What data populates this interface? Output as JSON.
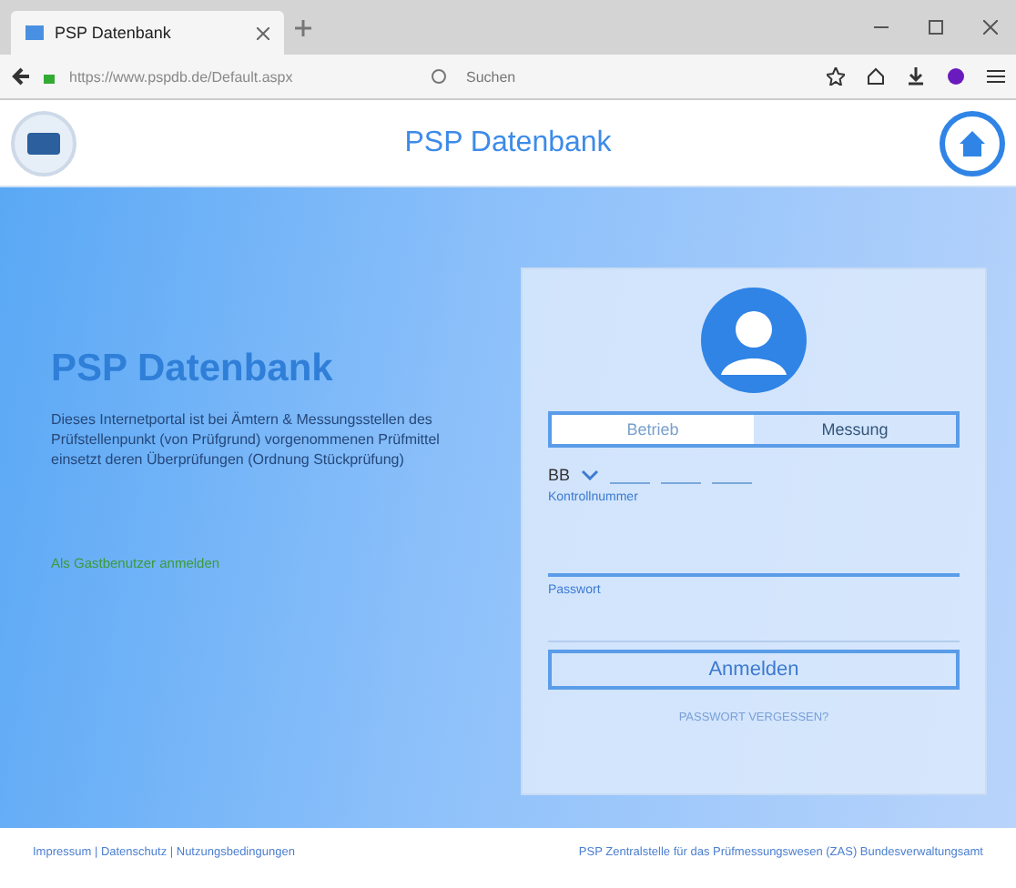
{
  "browser": {
    "tab_title": "PSP Datenbank",
    "address": "https://www.pspdb.de/Default.aspx",
    "search_placeholder": "Suchen"
  },
  "header": {
    "title": "PSP Datenbank"
  },
  "intro": {
    "heading": "PSP Datenbank",
    "text": "Dieses Internetportal ist bei Ämtern & Messungsstellen des Prüfstellenpunkt (von Prüfgrund) vorgenommenen Prüfmittel einsetzt deren Überprüfungen (Ordnung Stückprüfung)",
    "guest_link": "Als Gastbenutzer anmelden"
  },
  "login": {
    "tabs": [
      {
        "label": "Betrieb",
        "selected": true
      },
      {
        "label": "Messung",
        "selected": false
      }
    ],
    "prefix": "BB",
    "id_label": "Kontrollnummer",
    "password_label": "Passwort",
    "submit": "Anmelden",
    "forgot": "PASSWORT VERGESSEN?"
  },
  "footer": {
    "left": "Impressum | Datenschutz | Nutzungsbedingungen",
    "right": "PSP Zentralstelle für das Prüfmessungswesen (ZAS) Bundesverwaltungsamt"
  }
}
